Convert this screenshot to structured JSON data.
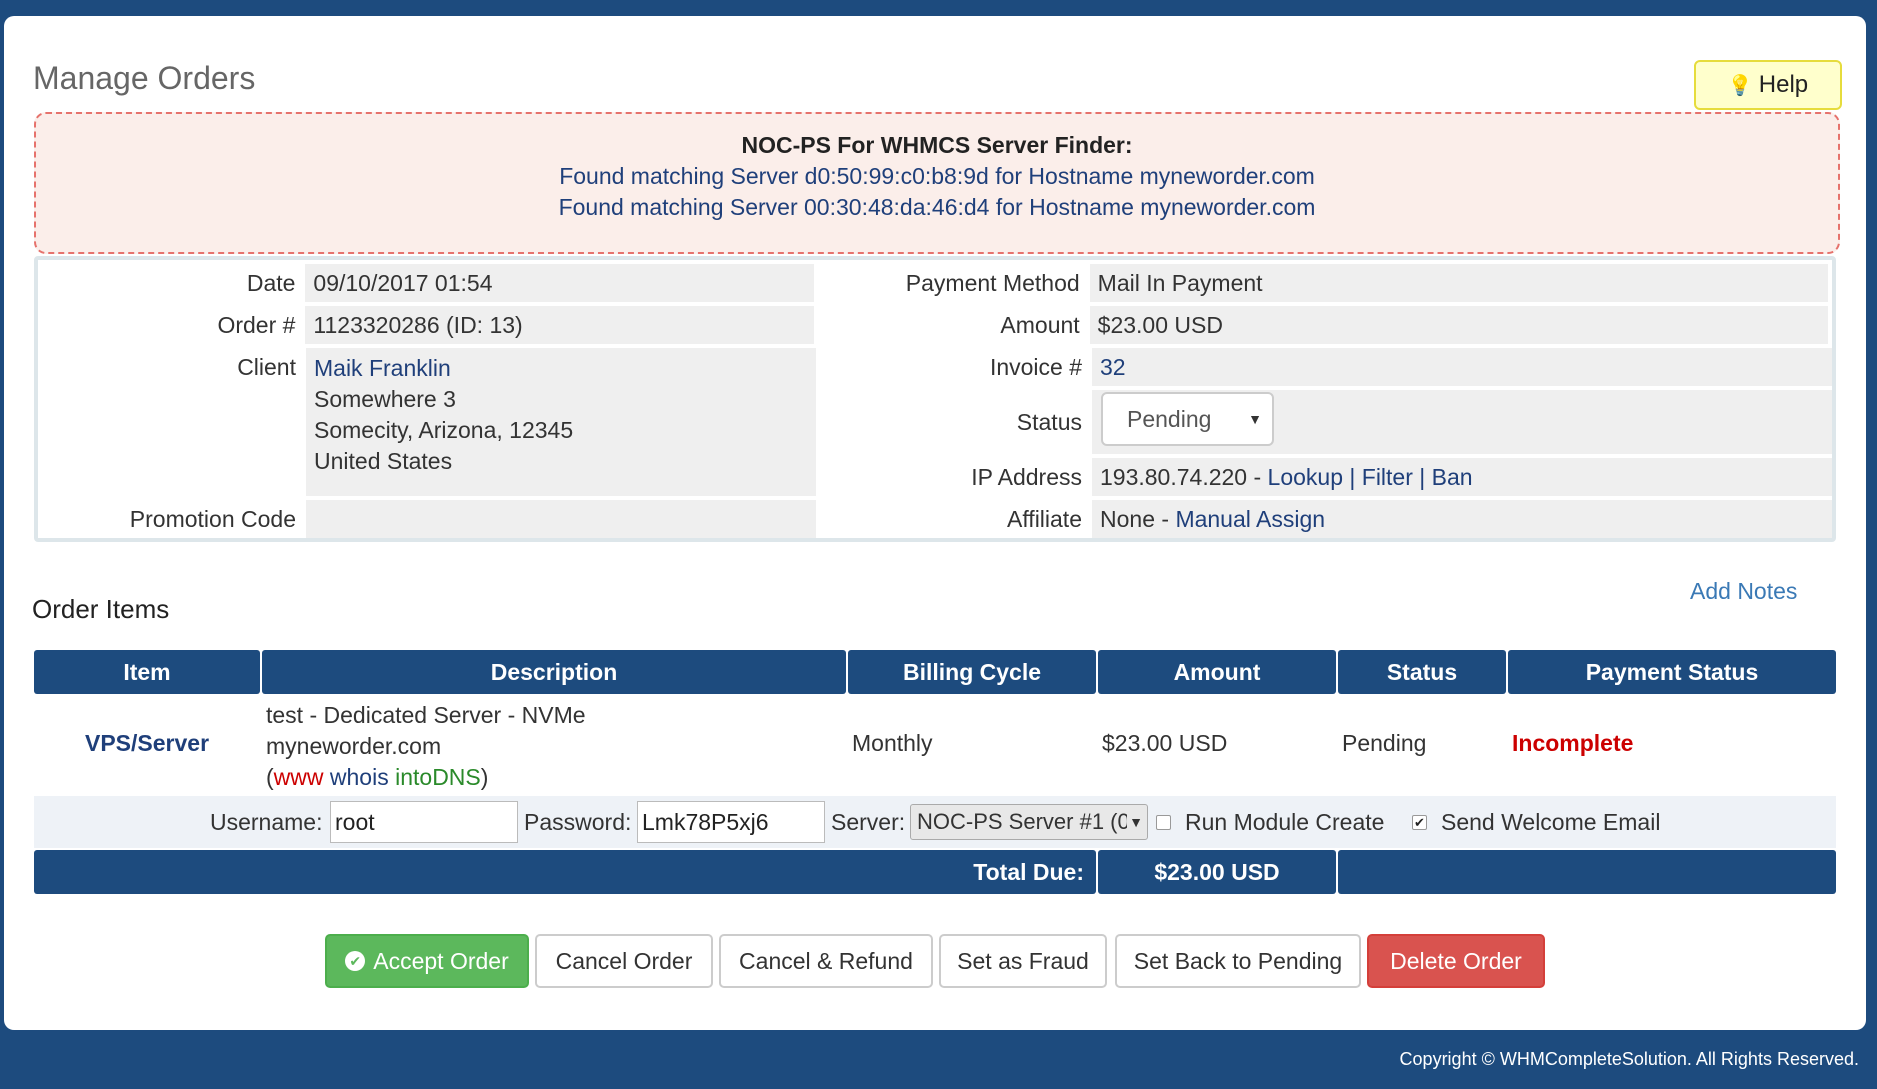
{
  "page": {
    "title": "Manage Orders",
    "help_label": "Help",
    "help_icon": "lightbulb-icon"
  },
  "alert": {
    "title": "NOC-PS For WHMCS Server Finder:",
    "lines": [
      "Found matching Server d0:50:99:c0:b8:9d for Hostname myneworder.com",
      "Found matching Server 00:30:48:da:46:d4 for Hostname myneworder.com"
    ]
  },
  "order": {
    "date_label": "Date",
    "date": "09/10/2017 01:54",
    "order_label": "Order #",
    "order_no": "1123320286 (ID: 13)",
    "client_label": "Client",
    "client_name": "Maik Franklin",
    "client_address": [
      "Somewhere 3",
      "Somecity, Arizona, 12345",
      "United States"
    ],
    "promo_label": "Promotion Code",
    "promo": "",
    "payment_method_label": "Payment Method",
    "payment_method": "Mail In Payment",
    "amount_label": "Amount",
    "amount": "$23.00 USD",
    "invoice_label": "Invoice #",
    "invoice": "32",
    "status_label": "Status",
    "status": "Pending",
    "ip_label": "IP Address",
    "ip": "193.80.74.220 - ",
    "ip_links": [
      "Lookup",
      "Filter",
      "Ban"
    ],
    "affiliate_label": "Affiliate",
    "affiliate": "None - ",
    "affiliate_link": "Manual Assign"
  },
  "items": {
    "title": "Order Items",
    "add_notes": "Add Notes",
    "headers": [
      "Item",
      "Description",
      "Billing Cycle",
      "Amount",
      "Status",
      "Payment Status"
    ],
    "row": {
      "item": "VPS/Server",
      "desc_line1": "test - Dedicated Server - NVMe",
      "desc_line2": "myneworder.com",
      "link_www": "www",
      "link_whois": "whois",
      "link_intodns": "intoDNS",
      "billing": "Monthly",
      "amount": "$23.00 USD",
      "status": "Pending",
      "payment_status": "Incomplete"
    },
    "setup": {
      "username_label": "Username:",
      "username": "root",
      "password_label": "Password:",
      "password": "Lmk78P5xj6",
      "server_label": "Server:",
      "server": "NOC-PS Server #1 (0",
      "run_module": "Run Module Create",
      "run_module_checked": false,
      "send_welcome": "Send Welcome Email",
      "send_welcome_checked": true
    },
    "total_label": "Total Due:",
    "total": "$23.00 USD"
  },
  "actions": {
    "accept": "Accept Order",
    "cancel": "Cancel Order",
    "refund": "Cancel & Refund",
    "fraud": "Set as Fraud",
    "pending": "Set Back to Pending",
    "delete": "Delete Order"
  },
  "footer": {
    "copyright": "Copyright © WHMCompleteSolution. All Rights Reserved."
  },
  "colors": {
    "header_blue": "#1d4b7e",
    "accept_green": "#5cb85c",
    "delete_red": "#d9534f",
    "incomplete_red": "#cc0000",
    "link_blue": "#1f3f7a"
  }
}
